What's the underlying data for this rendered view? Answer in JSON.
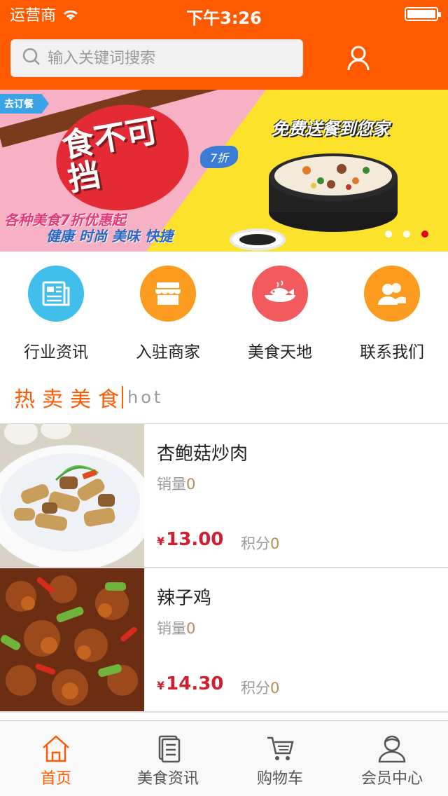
{
  "status_bar": {
    "carrier": "运营商",
    "time": "下午3:26"
  },
  "search": {
    "placeholder": "输入关键词搜索"
  },
  "banner": {
    "order_tag": "去订餐",
    "title": "食不可挡",
    "discount": "7折",
    "headline": "免费送餐到您家",
    "promo_line1": "各种美食7折优惠起",
    "promo_line2": "健康 时尚 美味 快捷",
    "active_slide": 3,
    "slide_count": 3
  },
  "categories": [
    {
      "label": "行业资讯",
      "color": "#3fbfe9",
      "icon": "news-icon"
    },
    {
      "label": "入驻商家",
      "color": "#fb9b20",
      "icon": "store-icon"
    },
    {
      "label": "美食天地",
      "color": "#f25a5e",
      "icon": "fish-icon"
    },
    {
      "label": "联系我们",
      "color": "#fb9b20",
      "icon": "contacts-icon"
    }
  ],
  "section": {
    "title": "热卖美食",
    "subtitle": "hot"
  },
  "products": [
    {
      "name": "杏鲍菇炒肉",
      "sales_label": "销量",
      "sales": "0",
      "currency": "¥",
      "price": "13.00",
      "points_label": "积分",
      "points": "0"
    },
    {
      "name": "辣子鸡",
      "sales_label": "销量",
      "sales": "0",
      "currency": "¥",
      "price": "14.30",
      "points_label": "积分",
      "points": "0"
    }
  ],
  "tabs": [
    {
      "label": "首页",
      "icon": "home-icon",
      "active": true
    },
    {
      "label": "美食资讯",
      "icon": "document-icon",
      "active": false
    },
    {
      "label": "购物车",
      "icon": "cart-icon",
      "active": false
    },
    {
      "label": "会员中心",
      "icon": "member-icon",
      "active": false
    }
  ],
  "colors": {
    "accent": "#ff5a00",
    "price": "#d01f2e"
  }
}
